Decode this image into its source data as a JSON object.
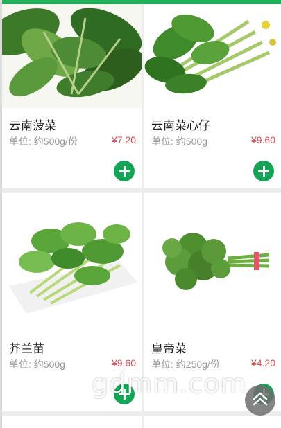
{
  "products": [
    {
      "name": "云南菠菜",
      "unit": "单位: 约500g/份",
      "price": "¥7.20"
    },
    {
      "name": "云南菜心仔",
      "unit": "单位: 约500g",
      "price": "¥9.60"
    },
    {
      "name": "芥兰苗",
      "unit": "单位: 约500g",
      "price": "¥9.60"
    },
    {
      "name": "皇帝菜",
      "unit": "单位: 约250g/份",
      "price": "¥4.20"
    }
  ],
  "watermark": "gdmm.com",
  "colors": {
    "accent_green": "#13a456",
    "price_red": "#e5484d",
    "top_bar": "#1db25a"
  },
  "icons": {
    "add": "plus-circle-icon",
    "back_to_top": "chevron-up-icon"
  }
}
